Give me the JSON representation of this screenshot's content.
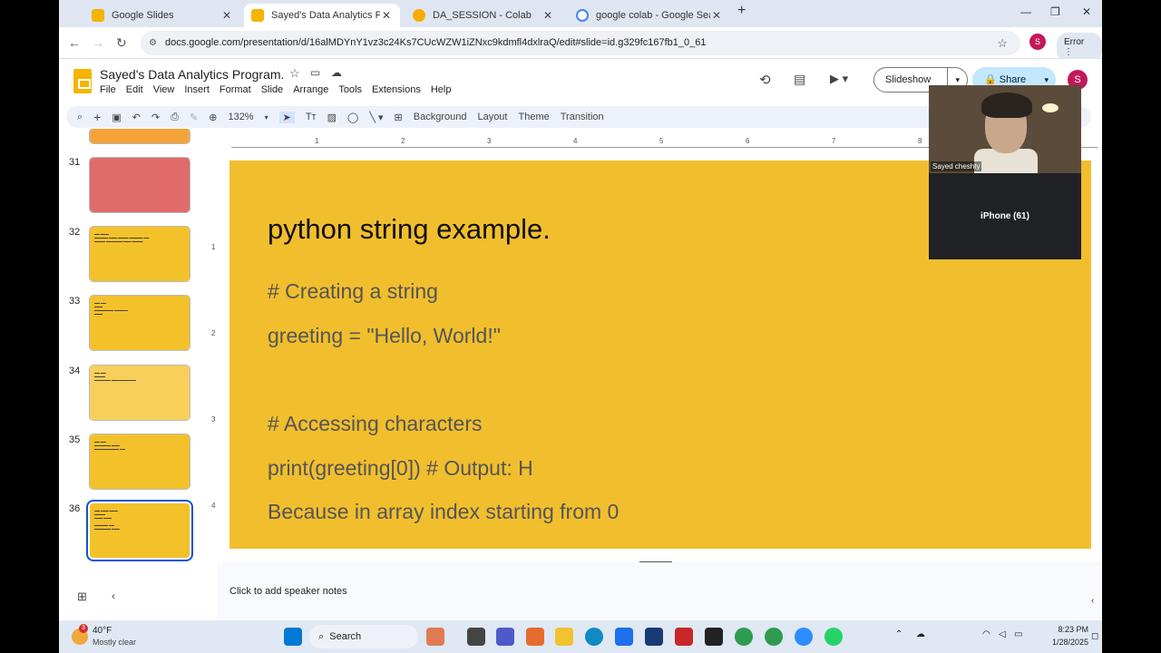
{
  "tabs": [
    {
      "title": "Google Slides",
      "color": "#f4b400"
    },
    {
      "title": "Sayed's Data Analytics Program",
      "color": "#f4b400"
    },
    {
      "title": "DA_SESSION - Colab",
      "color": "#f9ab00"
    },
    {
      "title": "google colab - Google Search",
      "color": "#4285f4"
    }
  ],
  "address": {
    "url": "docs.google.com/presentation/d/16alMDYnY1vz3c24Ks7CUcWZW1iZNxc9kdmfl4dxlraQ/edit#slide=id.g329fc167fb1_0_61",
    "error": "Error",
    "avatar": "S"
  },
  "doc": {
    "title": "Sayed's Data Analytics Program."
  },
  "menus": [
    "File",
    "Edit",
    "View",
    "Insert",
    "Format",
    "Slide",
    "Arrange",
    "Tools",
    "Extensions",
    "Help"
  ],
  "actions": {
    "slideshow": "Slideshow",
    "share": "Share",
    "avatar": "S"
  },
  "toolbar": {
    "zoom": "132%",
    "background": "Background",
    "layout": "Layout",
    "theme": "Theme",
    "transition": "Transition"
  },
  "ruler": [
    "1",
    "2",
    "3",
    "4",
    "5",
    "6",
    "7",
    "8"
  ],
  "vruler": [
    "1",
    "2",
    "3",
    "4"
  ],
  "thumbnails": [
    {
      "num": "31"
    },
    {
      "num": "32"
    },
    {
      "num": "33"
    },
    {
      "num": "34"
    },
    {
      "num": "35"
    },
    {
      "num": "36"
    }
  ],
  "slide": {
    "title": "python string example.",
    "lines": [
      "# Creating a string",
      "greeting = \"Hello, World!\"",
      "# Accessing characters",
      "print(greeting[0])  # Output: H",
      "Because in array index starting from 0"
    ]
  },
  "video": {
    "name": "Sayed cheshty",
    "device": "iPhone (61)"
  },
  "notes": "Click to add speaker notes",
  "taskbar": {
    "temp": "40°F",
    "weather": "Mostly clear",
    "badge": "3",
    "search": "Search",
    "time": "8:23 PM",
    "date": "1/28/2025"
  }
}
